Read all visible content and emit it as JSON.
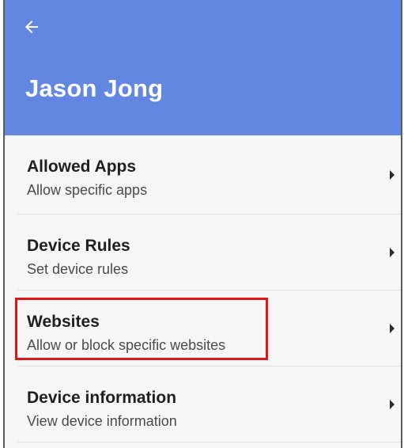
{
  "header": {
    "title": "Jason Jong",
    "back_icon": "arrow-left-icon",
    "background_color": "#6187e1"
  },
  "items": [
    {
      "title": "Allowed Apps",
      "subtitle": "Allow specific apps",
      "icon": "chevron-right-icon"
    },
    {
      "title": "Device Rules",
      "subtitle": "Set device rules",
      "icon": "chevron-right-icon"
    },
    {
      "title": "Websites",
      "subtitle": "Allow or block specific websites",
      "icon": "chevron-right-icon"
    },
    {
      "title": "Device information",
      "subtitle": "View device information",
      "icon": "chevron-right-icon"
    }
  ],
  "highlight": {
    "target": "Websites",
    "color": "#e01515"
  }
}
